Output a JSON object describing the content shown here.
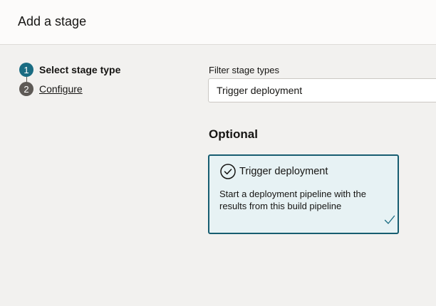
{
  "header": {
    "title": "Add a stage"
  },
  "steps": [
    {
      "number": "1",
      "label": "Select stage type",
      "state": "active"
    },
    {
      "number": "2",
      "label": "Configure",
      "state": "inactive"
    }
  ],
  "filter": {
    "label": "Filter stage types",
    "value": "Trigger deployment"
  },
  "section": {
    "heading": "Optional"
  },
  "card": {
    "title": "Trigger deployment",
    "description": "Start a deployment pipeline with the results from this build pipeline",
    "icon": "circle-check-icon",
    "selected_icon": "checkmark-icon",
    "selected": true
  },
  "colors": {
    "accent": "#1a6c82",
    "card_border": "#175d70",
    "card_background": "#e7f2f4",
    "background": "#f2f1ef"
  }
}
